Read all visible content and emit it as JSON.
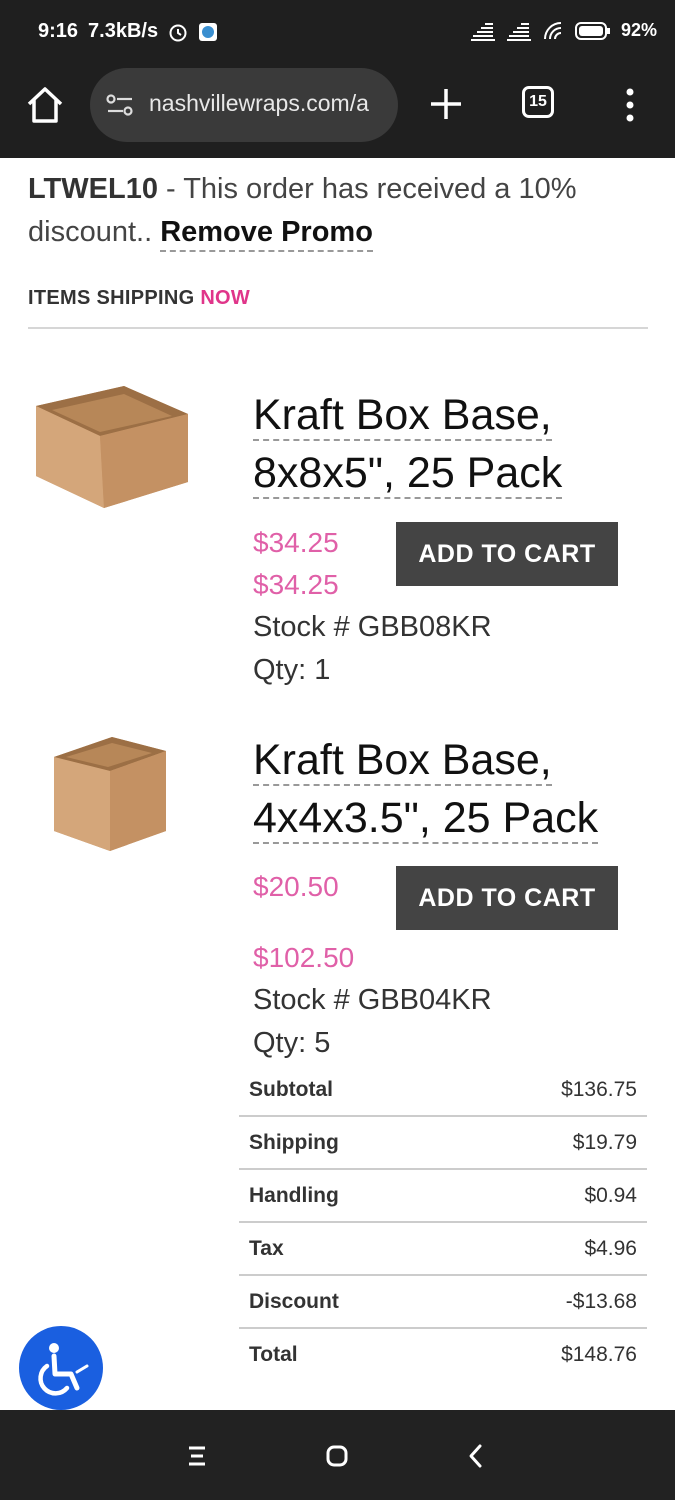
{
  "status_bar": {
    "time": "9:16",
    "net_speed": "7.3kB/s",
    "battery": "92%",
    "icons": [
      "alarm-icon",
      "app-notification-icon",
      "signal-icon",
      "signal-icon-2",
      "wifi-icon",
      "battery-icon"
    ]
  },
  "browser": {
    "url": "nashvillewraps.com/a",
    "tab_count": "15"
  },
  "promo": {
    "code": "LTWEL10",
    "message": " - This order has received a 10% discount.. ",
    "remove_label": "Remove Promo"
  },
  "section": {
    "title": "ITEMS SHIPPING ",
    "highlight": "NOW",
    "highlight_color": "#e0358a"
  },
  "products": [
    {
      "title_line1": "Kraft Box Base,",
      "title_line2": "8x8x5\", 25 Pack",
      "unit_price": "$34.25",
      "line_total": "$34.25",
      "stock": "Stock # GBB08KR",
      "qty": "Qty: 1",
      "button": "ADD TO CART"
    },
    {
      "title_line1": "Kraft Box Base,",
      "title_line2": "4x4x3.5\", 25 Pack",
      "unit_price": "$20.50",
      "line_total": "$102.50",
      "stock": "Stock # GBB04KR",
      "qty": "Qty: 5",
      "button": "ADD TO CART"
    }
  ],
  "summary": [
    {
      "label": "Subtotal",
      "value": "$136.75"
    },
    {
      "label": "Shipping",
      "value": "$19.79"
    },
    {
      "label": "Handling",
      "value": "$0.94"
    },
    {
      "label": "Tax",
      "value": "$4.96"
    },
    {
      "label": "Discount",
      "value": "-$13.68"
    },
    {
      "label": "Total",
      "value": "$148.76"
    }
  ],
  "colors": {
    "price": "#e060a8",
    "button": "#444444",
    "accessibility": "#1a5fe0"
  }
}
